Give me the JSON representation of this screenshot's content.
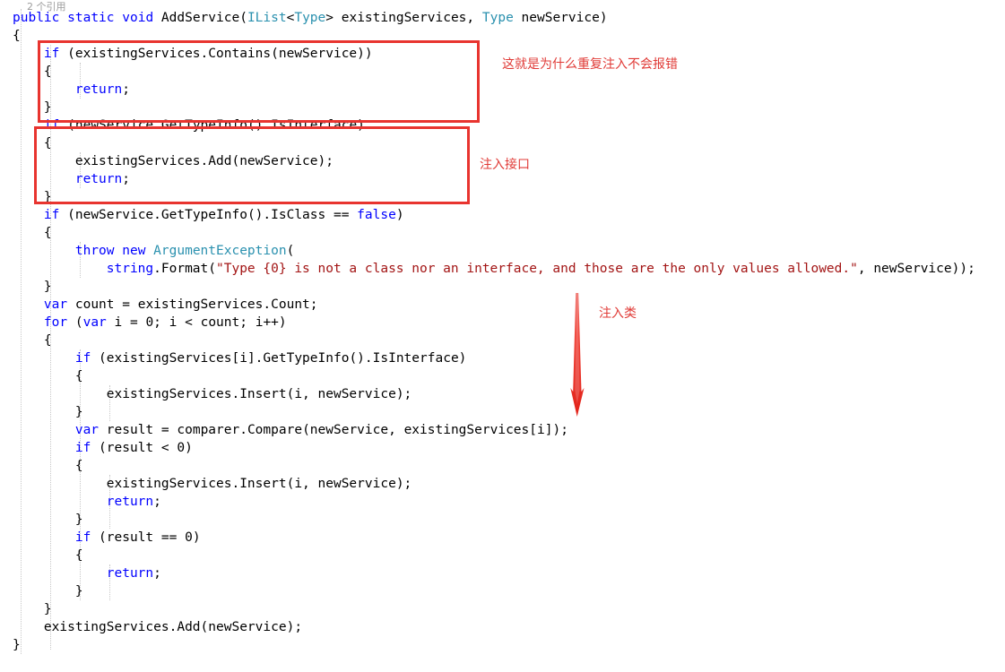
{
  "editor": {
    "codelens": "2 个引用",
    "background_color": "#ffffff",
    "keyword_color": "#0000ff",
    "type_color": "#2b91af",
    "string_color": "#a31515",
    "text_color": "#000000",
    "indent_guide_color": "#c8c8c8",
    "lines": [
      {
        "indent": 0,
        "text": "public static void AddService(IList<Type> existingServices, Type newService)"
      },
      {
        "indent": 0,
        "text": "{"
      },
      {
        "indent": 1,
        "text": "if (existingServices.Contains(newService))"
      },
      {
        "indent": 1,
        "text": "{"
      },
      {
        "indent": 2,
        "text": "return;"
      },
      {
        "indent": 1,
        "text": "}"
      },
      {
        "indent": 1,
        "text": "if (newService.GetTypeInfo().IsInterface)"
      },
      {
        "indent": 1,
        "text": "{"
      },
      {
        "indent": 2,
        "text": "existingServices.Add(newService);"
      },
      {
        "indent": 2,
        "text": "return;"
      },
      {
        "indent": 1,
        "text": "}"
      },
      {
        "indent": 1,
        "text": "if (newService.GetTypeInfo().IsClass == false)"
      },
      {
        "indent": 1,
        "text": "{"
      },
      {
        "indent": 2,
        "text": "throw new ArgumentException("
      },
      {
        "indent": 3,
        "text": "string.Format(\"Type {0} is not a class nor an interface, and those are the only values allowed.\", newService));"
      },
      {
        "indent": 1,
        "text": "}"
      },
      {
        "indent": 1,
        "text": "var count = existingServices.Count;"
      },
      {
        "indent": 1,
        "text": "for (var i = 0; i < count; i++)"
      },
      {
        "indent": 1,
        "text": "{"
      },
      {
        "indent": 2,
        "text": "if (existingServices[i].GetTypeInfo().IsInterface)"
      },
      {
        "indent": 2,
        "text": "{"
      },
      {
        "indent": 3,
        "text": "existingServices.Insert(i, newService);"
      },
      {
        "indent": 2,
        "text": "}"
      },
      {
        "indent": 2,
        "text": "var result = comparer.Compare(newService, existingServices[i]);"
      },
      {
        "indent": 2,
        "text": "if (result < 0)"
      },
      {
        "indent": 2,
        "text": "{"
      },
      {
        "indent": 3,
        "text": "existingServices.Insert(i, newService);"
      },
      {
        "indent": 3,
        "text": "return;"
      },
      {
        "indent": 2,
        "text": "}"
      },
      {
        "indent": 2,
        "text": "if (result == 0)"
      },
      {
        "indent": 2,
        "text": "{"
      },
      {
        "indent": 3,
        "text": "return;"
      },
      {
        "indent": 2,
        "text": "}"
      },
      {
        "indent": 1,
        "text": "}"
      },
      {
        "indent": 1,
        "text": "existingServices.Add(newService);"
      },
      {
        "indent": 0,
        "text": "}"
      }
    ]
  },
  "annotations": {
    "color": "#e03a36",
    "box_color": "#e8342f",
    "notes": [
      {
        "label": "这就是为什么重复注入不会报错"
      },
      {
        "label": "注入接口"
      },
      {
        "label": "注入类"
      }
    ]
  }
}
